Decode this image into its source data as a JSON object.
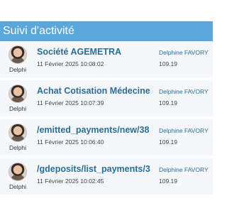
{
  "header": {
    "title": "Suivi d'activité"
  },
  "activities": [
    {
      "avatar_name": "Delphi",
      "title": "Société AGEMETRA",
      "date": "11 Février 2025 10:08:02",
      "user": "Delphine FAVORY",
      "ip": "109.19"
    },
    {
      "avatar_name": "Delphi",
      "title": "Achat Cotisation Médecine c",
      "date": "11 Février 2025 10:07:39",
      "user": "Delphine FAVORY",
      "ip": "109.19"
    },
    {
      "avatar_name": "Delphi",
      "title": "/emitted_payments/new/38",
      "date": "11 Février 2025 10:06:40",
      "user": "Delphine FAVORY",
      "ip": "109.19"
    },
    {
      "avatar_name": "Delphi",
      "title": "/gdeposits/list_payments/3",
      "date": "11 Février 2025 10:02:45",
      "user": "Delphine FAVORY",
      "ip": "109.19"
    }
  ],
  "colors": {
    "header_bg": "#5aa7dc",
    "link": "#2a6e97",
    "row_bg": "#f5f7fa"
  }
}
